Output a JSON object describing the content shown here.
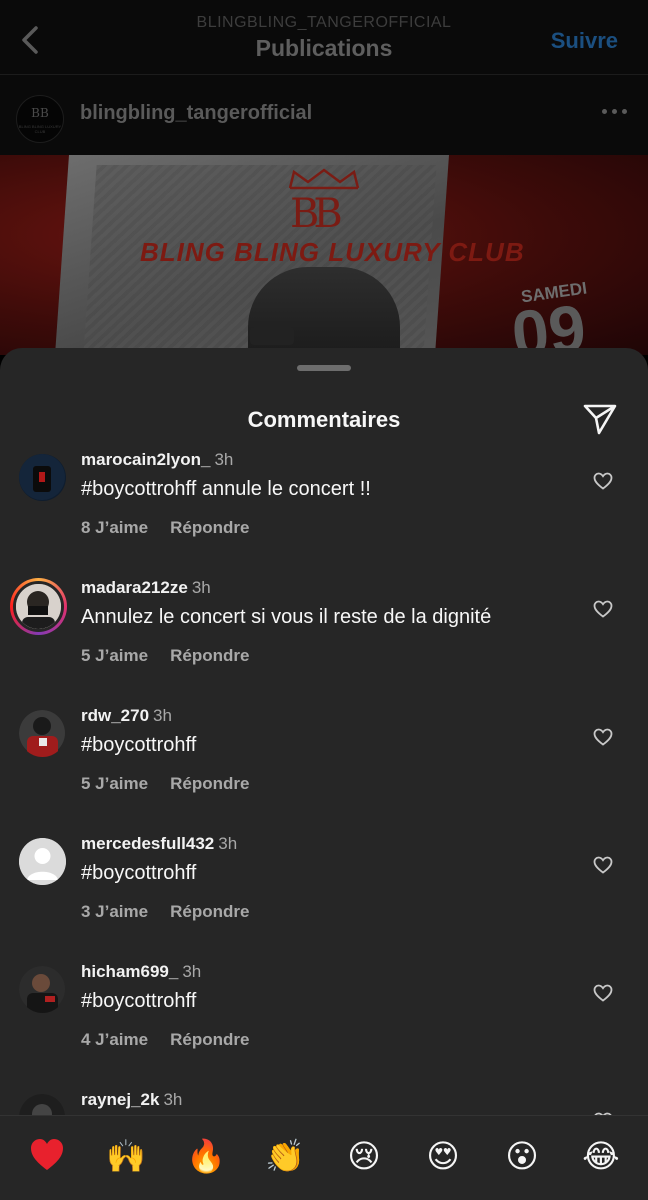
{
  "header": {
    "account": "BLINGBLING_TANGEROFFICIAL",
    "title": "Publications",
    "follow_label": "Suivre",
    "back_icon": "chevron-left-icon"
  },
  "post": {
    "username": "blingbling_tangerofficial",
    "avatar_text": "BB",
    "avatar_subtext": "BLING BLING LUXURY CLUB",
    "image": {
      "brand_mark": "BB",
      "club_name": "BLING BLING LUXURY CLUB",
      "day_label": "SAMEDI",
      "day_number": "09"
    }
  },
  "sheet": {
    "title": "Commentaires",
    "send_icon": "send-icon"
  },
  "comments": [
    {
      "username": "marocain2lyon_",
      "time": "3h",
      "text": "#boycottrohff annule le concert !!",
      "likes": "8 J’aime",
      "reply": "Répondre"
    },
    {
      "username": "madara212ze",
      "time": "3h",
      "text": "Annulez le concert si vous il reste de la dignité",
      "likes": "5 J’aime",
      "reply": "Répondre"
    },
    {
      "username": "rdw_270",
      "time": "3h",
      "text": "#boycottrohff",
      "likes": "5 J’aime",
      "reply": "Répondre"
    },
    {
      "username": "mercedesfull432",
      "time": "3h",
      "text": "#boycottrohff",
      "likes": "3 J’aime",
      "reply": "Répondre"
    },
    {
      "username": "hicham699_",
      "time": "3h",
      "text": "#boycottrohff",
      "likes": "4 J’aime",
      "reply": "Répondre"
    },
    {
      "username": "raynej_2k",
      "time": "3h",
      "text": "",
      "likes": "",
      "reply": ""
    }
  ],
  "emoji_bar": [
    {
      "name": "red-heart",
      "char": "❤️"
    },
    {
      "name": "raising-hands",
      "char": "🙌"
    },
    {
      "name": "fire",
      "char": "🔥"
    },
    {
      "name": "clapping-hands",
      "char": "👏"
    },
    {
      "name": "crying-face",
      "char": "😢"
    },
    {
      "name": "heart-eyes",
      "char": "😍"
    },
    {
      "name": "surprised-face",
      "char": "😮"
    },
    {
      "name": "tears-of-joy",
      "char": "😂"
    }
  ],
  "colors": {
    "sheet_bg": "#262626",
    "follow_blue": "#1b4f80",
    "muted_text": "#a8a8a8"
  }
}
